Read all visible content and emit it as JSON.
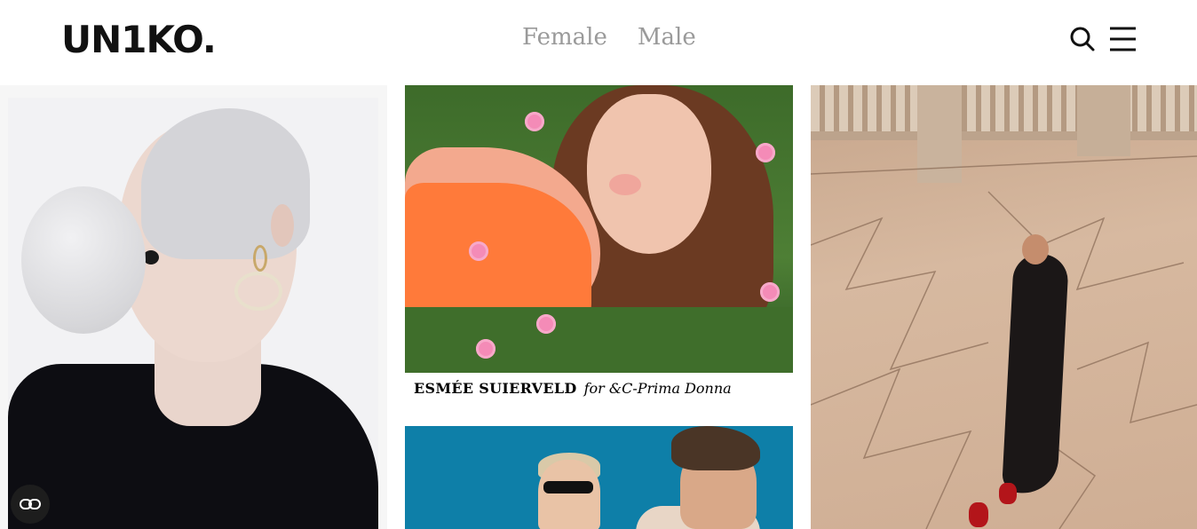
{
  "header": {
    "logo": "UN1KO.",
    "nav": [
      {
        "label": "Female"
      },
      {
        "label": "Male"
      }
    ],
    "icons": [
      "search-icon",
      "hamburger-menu-icon"
    ]
  },
  "feed": {
    "caption": {
      "name": "ESMÉE SUIERVELD",
      "for_text": "for &C-Prima Donna"
    }
  },
  "colors": {
    "nav_text": "#9a9a9a",
    "logo": "#111111",
    "widget_bg": "#1d1d1d"
  },
  "widget": {
    "icon": "privacy-link-icon"
  }
}
